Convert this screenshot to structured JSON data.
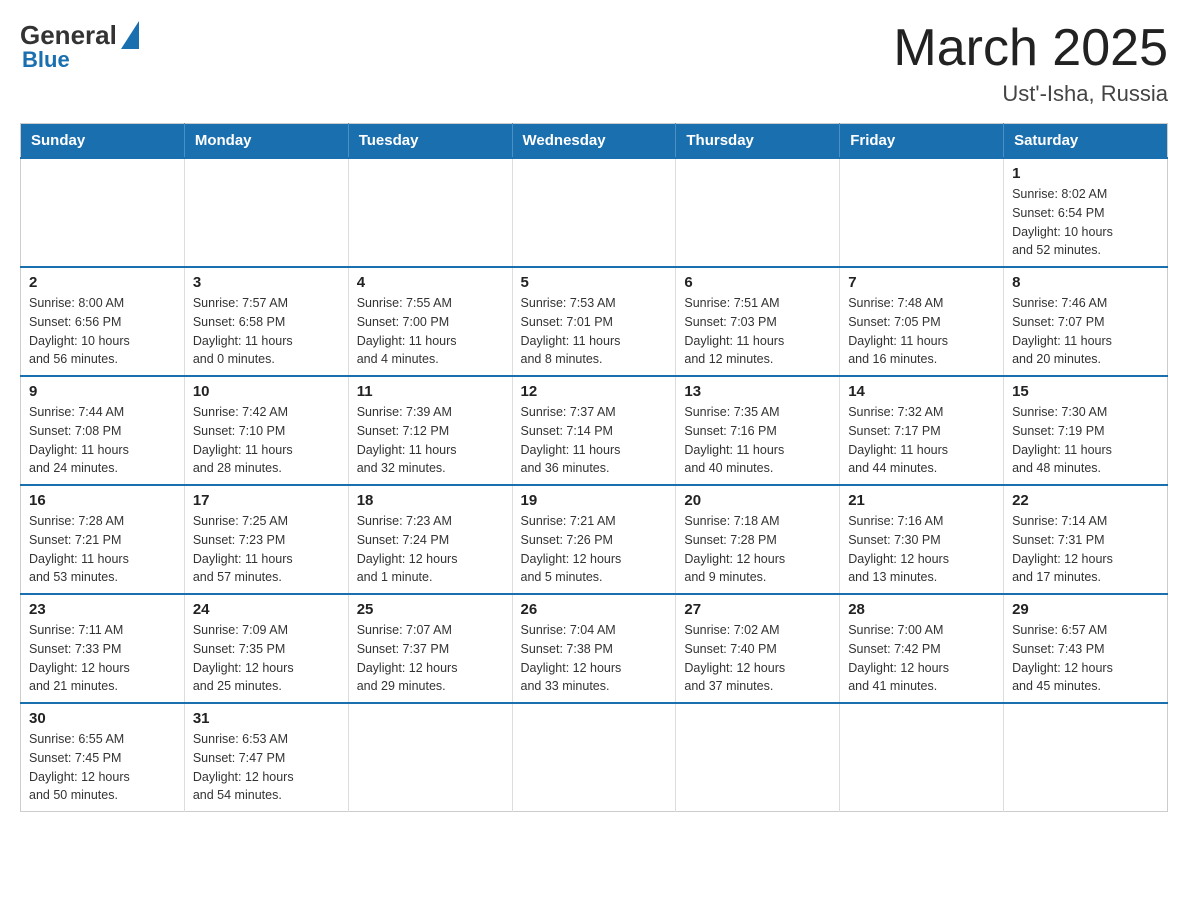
{
  "header": {
    "logo_general": "General",
    "logo_blue": "Blue",
    "month_title": "March 2025",
    "location": "Ust'-Isha, Russia"
  },
  "days_of_week": [
    "Sunday",
    "Monday",
    "Tuesday",
    "Wednesday",
    "Thursday",
    "Friday",
    "Saturday"
  ],
  "weeks": [
    [
      {
        "day": "",
        "info": ""
      },
      {
        "day": "",
        "info": ""
      },
      {
        "day": "",
        "info": ""
      },
      {
        "day": "",
        "info": ""
      },
      {
        "day": "",
        "info": ""
      },
      {
        "day": "",
        "info": ""
      },
      {
        "day": "1",
        "info": "Sunrise: 8:02 AM\nSunset: 6:54 PM\nDaylight: 10 hours\nand 52 minutes."
      }
    ],
    [
      {
        "day": "2",
        "info": "Sunrise: 8:00 AM\nSunset: 6:56 PM\nDaylight: 10 hours\nand 56 minutes."
      },
      {
        "day": "3",
        "info": "Sunrise: 7:57 AM\nSunset: 6:58 PM\nDaylight: 11 hours\nand 0 minutes."
      },
      {
        "day": "4",
        "info": "Sunrise: 7:55 AM\nSunset: 7:00 PM\nDaylight: 11 hours\nand 4 minutes."
      },
      {
        "day": "5",
        "info": "Sunrise: 7:53 AM\nSunset: 7:01 PM\nDaylight: 11 hours\nand 8 minutes."
      },
      {
        "day": "6",
        "info": "Sunrise: 7:51 AM\nSunset: 7:03 PM\nDaylight: 11 hours\nand 12 minutes."
      },
      {
        "day": "7",
        "info": "Sunrise: 7:48 AM\nSunset: 7:05 PM\nDaylight: 11 hours\nand 16 minutes."
      },
      {
        "day": "8",
        "info": "Sunrise: 7:46 AM\nSunset: 7:07 PM\nDaylight: 11 hours\nand 20 minutes."
      }
    ],
    [
      {
        "day": "9",
        "info": "Sunrise: 7:44 AM\nSunset: 7:08 PM\nDaylight: 11 hours\nand 24 minutes."
      },
      {
        "day": "10",
        "info": "Sunrise: 7:42 AM\nSunset: 7:10 PM\nDaylight: 11 hours\nand 28 minutes."
      },
      {
        "day": "11",
        "info": "Sunrise: 7:39 AM\nSunset: 7:12 PM\nDaylight: 11 hours\nand 32 minutes."
      },
      {
        "day": "12",
        "info": "Sunrise: 7:37 AM\nSunset: 7:14 PM\nDaylight: 11 hours\nand 36 minutes."
      },
      {
        "day": "13",
        "info": "Sunrise: 7:35 AM\nSunset: 7:16 PM\nDaylight: 11 hours\nand 40 minutes."
      },
      {
        "day": "14",
        "info": "Sunrise: 7:32 AM\nSunset: 7:17 PM\nDaylight: 11 hours\nand 44 minutes."
      },
      {
        "day": "15",
        "info": "Sunrise: 7:30 AM\nSunset: 7:19 PM\nDaylight: 11 hours\nand 48 minutes."
      }
    ],
    [
      {
        "day": "16",
        "info": "Sunrise: 7:28 AM\nSunset: 7:21 PM\nDaylight: 11 hours\nand 53 minutes."
      },
      {
        "day": "17",
        "info": "Sunrise: 7:25 AM\nSunset: 7:23 PM\nDaylight: 11 hours\nand 57 minutes."
      },
      {
        "day": "18",
        "info": "Sunrise: 7:23 AM\nSunset: 7:24 PM\nDaylight: 12 hours\nand 1 minute."
      },
      {
        "day": "19",
        "info": "Sunrise: 7:21 AM\nSunset: 7:26 PM\nDaylight: 12 hours\nand 5 minutes."
      },
      {
        "day": "20",
        "info": "Sunrise: 7:18 AM\nSunset: 7:28 PM\nDaylight: 12 hours\nand 9 minutes."
      },
      {
        "day": "21",
        "info": "Sunrise: 7:16 AM\nSunset: 7:30 PM\nDaylight: 12 hours\nand 13 minutes."
      },
      {
        "day": "22",
        "info": "Sunrise: 7:14 AM\nSunset: 7:31 PM\nDaylight: 12 hours\nand 17 minutes."
      }
    ],
    [
      {
        "day": "23",
        "info": "Sunrise: 7:11 AM\nSunset: 7:33 PM\nDaylight: 12 hours\nand 21 minutes."
      },
      {
        "day": "24",
        "info": "Sunrise: 7:09 AM\nSunset: 7:35 PM\nDaylight: 12 hours\nand 25 minutes."
      },
      {
        "day": "25",
        "info": "Sunrise: 7:07 AM\nSunset: 7:37 PM\nDaylight: 12 hours\nand 29 minutes."
      },
      {
        "day": "26",
        "info": "Sunrise: 7:04 AM\nSunset: 7:38 PM\nDaylight: 12 hours\nand 33 minutes."
      },
      {
        "day": "27",
        "info": "Sunrise: 7:02 AM\nSunset: 7:40 PM\nDaylight: 12 hours\nand 37 minutes."
      },
      {
        "day": "28",
        "info": "Sunrise: 7:00 AM\nSunset: 7:42 PM\nDaylight: 12 hours\nand 41 minutes."
      },
      {
        "day": "29",
        "info": "Sunrise: 6:57 AM\nSunset: 7:43 PM\nDaylight: 12 hours\nand 45 minutes."
      }
    ],
    [
      {
        "day": "30",
        "info": "Sunrise: 6:55 AM\nSunset: 7:45 PM\nDaylight: 12 hours\nand 50 minutes."
      },
      {
        "day": "31",
        "info": "Sunrise: 6:53 AM\nSunset: 7:47 PM\nDaylight: 12 hours\nand 54 minutes."
      },
      {
        "day": "",
        "info": ""
      },
      {
        "day": "",
        "info": ""
      },
      {
        "day": "",
        "info": ""
      },
      {
        "day": "",
        "info": ""
      },
      {
        "day": "",
        "info": ""
      }
    ]
  ]
}
